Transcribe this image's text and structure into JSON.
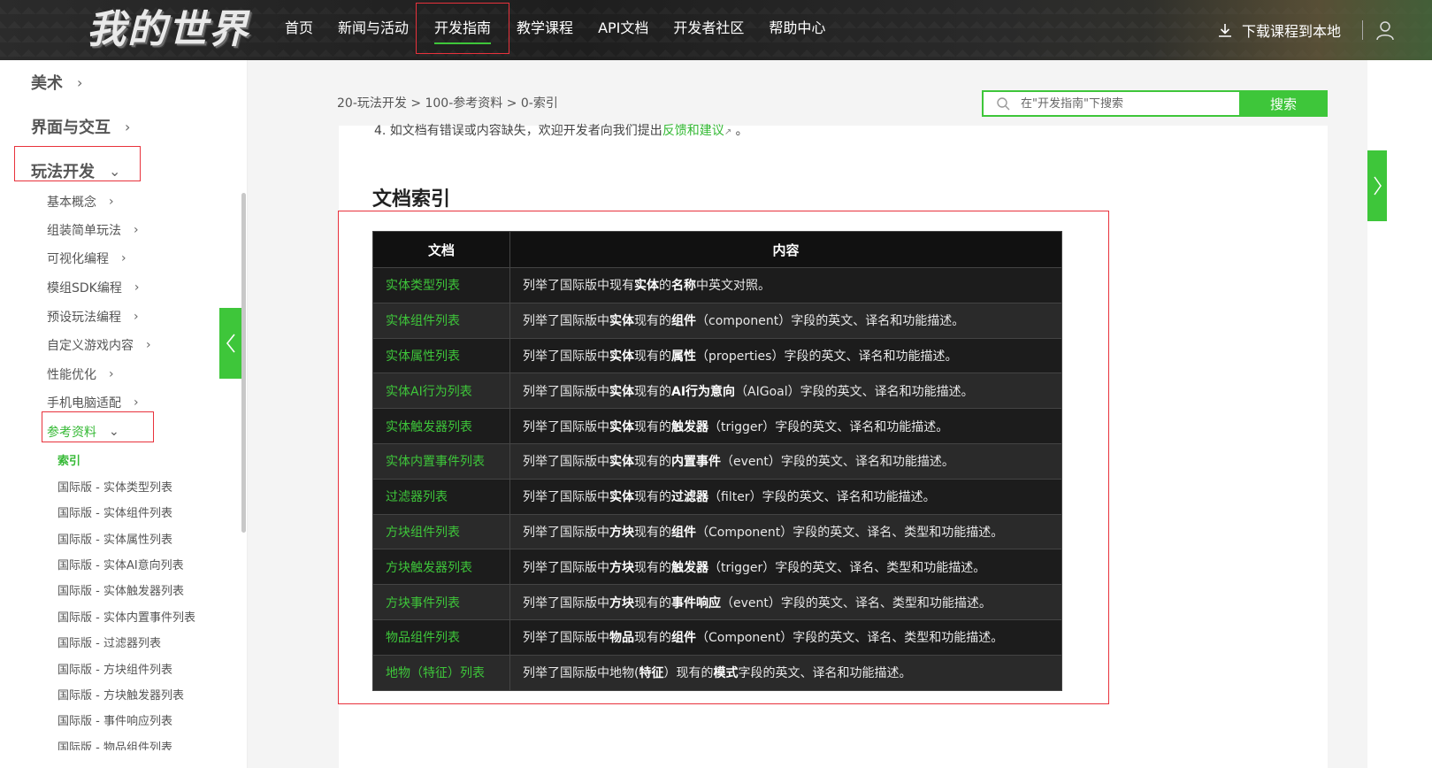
{
  "header": {
    "logo_text": "我的世界",
    "nav": [
      {
        "label": "首页"
      },
      {
        "label": "新闻与活动"
      },
      {
        "label": "开发指南"
      },
      {
        "label": "教学课程"
      },
      {
        "label": "API文档"
      },
      {
        "label": "开发者社区"
      },
      {
        "label": "帮助中心"
      }
    ],
    "active_nav": "开发指南",
    "download_label": "下载课程到本地"
  },
  "sidebar": {
    "top_items": [
      {
        "label": "美术"
      },
      {
        "label": "界面与交互"
      },
      {
        "label": "玩法开发"
      }
    ],
    "sub_items": [
      {
        "label": "基本概念"
      },
      {
        "label": "组装简单玩法"
      },
      {
        "label": "可视化编程"
      },
      {
        "label": "模组SDK编程"
      },
      {
        "label": "预设玩法编程"
      },
      {
        "label": "自定义游戏内容"
      },
      {
        "label": "性能优化"
      },
      {
        "label": "手机电脑适配"
      },
      {
        "label": "参考资料"
      }
    ],
    "leaf_items": [
      {
        "label": "索引"
      },
      {
        "label": "国际版 - 实体类型列表"
      },
      {
        "label": "国际版 - 实体组件列表"
      },
      {
        "label": "国际版 - 实体属性列表"
      },
      {
        "label": "国际版 - 实体AI意向列表"
      },
      {
        "label": "国际版 - 实体触发器列表"
      },
      {
        "label": "国际版 - 实体内置事件列表"
      },
      {
        "label": "国际版 - 过滤器列表"
      },
      {
        "label": "国际版 - 方块组件列表"
      },
      {
        "label": "国际版 - 方块触发器列表"
      },
      {
        "label": "国际版 - 事件响应列表"
      },
      {
        "label": "国际版 - 物品组件列表"
      }
    ]
  },
  "breadcrumb": "20-玩法开发 > 100-参考资料 > 0-索引",
  "search": {
    "placeholder": "在\"开发指南\"下搜索",
    "button": "搜索"
  },
  "notice": {
    "prefix": "4. 如文档有错误或内容缺失，欢迎开发者向我们提出",
    "link": "反馈和建议",
    "suffix": " 。"
  },
  "section_title": "文档索引",
  "table": {
    "headers": [
      "文档",
      "内容"
    ],
    "rows": [
      {
        "doc": "实体类型列表",
        "desc": "列举了国际版中现有<b>实体</b>的<b>名称</b>中英文对照。"
      },
      {
        "doc": "实体组件列表",
        "desc": "列举了国际版中<b>实体</b>现有的<b>组件</b>（component）字段的英文、译名和功能描述。"
      },
      {
        "doc": "实体属性列表",
        "desc": "列举了国际版中<b>实体</b>现有的<b>属性</b>（properties）字段的英文、译名和功能描述。"
      },
      {
        "doc": "实体AI行为列表",
        "desc": "列举了国际版中<b>实体</b>现有的<b>AI行为意向</b>（AIGoal）字段的英文、译名和功能描述。"
      },
      {
        "doc": "实体触发器列表",
        "desc": "列举了国际版中<b>实体</b>现有的<b>触发器</b>（trigger）字段的英文、译名和功能描述。"
      },
      {
        "doc": "实体内置事件列表",
        "desc": "列举了国际版中<b>实体</b>现有的<b>内置事件</b>（event）字段的英文、译名和功能描述。"
      },
      {
        "doc": "过滤器列表",
        "desc": "列举了国际版中<b>实体</b>现有的<b>过滤器</b>（filter）字段的英文、译名和功能描述。"
      },
      {
        "doc": "方块组件列表",
        "desc": "列举了国际版中<b>方块</b>现有的<b>组件</b>（Component）字段的英文、译名、类型和功能描述。"
      },
      {
        "doc": "方块触发器列表",
        "desc": "列举了国际版中<b>方块</b>现有的<b>触发器</b>（trigger）字段的英文、译名、类型和功能描述。"
      },
      {
        "doc": "方块事件列表",
        "desc": "列举了国际版中<b>方块</b>现有的<b>事件响应</b>（event）字段的英文、译名、类型和功能描述。"
      },
      {
        "doc": "物品组件列表",
        "desc": "列举了国际版中<b>物品</b>现有的<b>组件</b>（Component）字段的英文、译名、类型和功能描述。"
      },
      {
        "doc": "地物（特征）列表",
        "desc": "列举了国际版中地物(<b>特征</b>）现有的<b>模式</b>字段的英文、译名和功能描述。"
      }
    ]
  },
  "colors": {
    "accent_green": "#3ec63a",
    "highlight_red": "#e8323c",
    "table_bg": "#1c1c1c"
  },
  "icons": {
    "download": "download-icon",
    "search": "search-icon",
    "sidebar_collapse": "chevron-left-icon",
    "right_panel": "chevron-right-icon"
  }
}
